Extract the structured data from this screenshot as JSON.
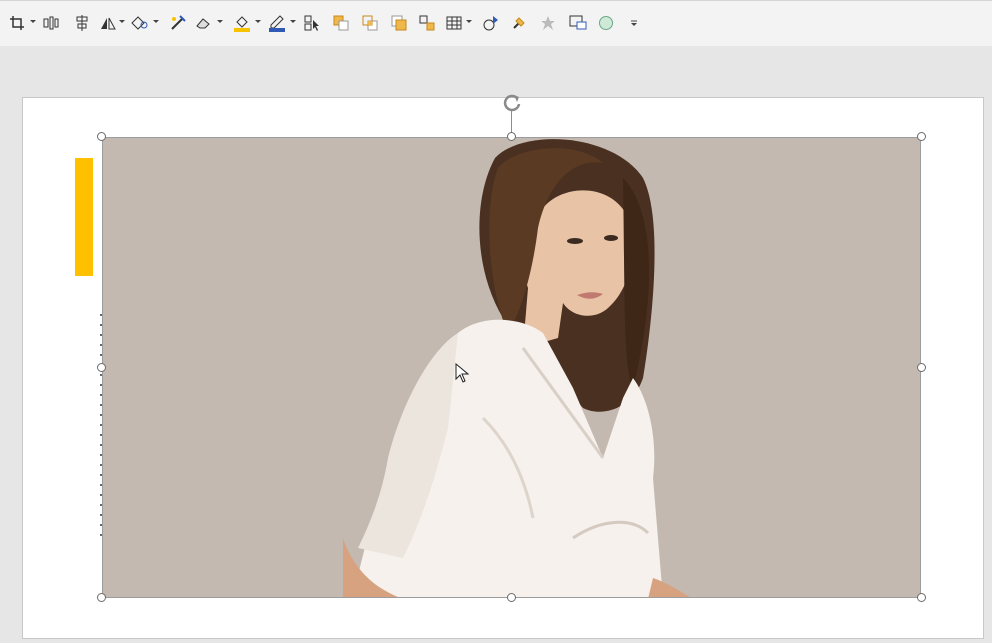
{
  "toolbar": {
    "items": [
      {
        "icon": "crop-icon"
      },
      {
        "icon": "align-objects-icon"
      },
      {
        "icon": "distribute-icon"
      },
      {
        "icon": "rotate-flip-icon"
      },
      {
        "icon": "edit-shape-icon"
      },
      {
        "icon": "artistic-effects-icon"
      },
      {
        "icon": "eraser-icon"
      },
      {
        "icon": "fill-color-icon",
        "accent": "#f7c200"
      },
      {
        "icon": "outline-color-icon",
        "accent": "#2f5bb7"
      },
      {
        "icon": "selection-pane-icon"
      },
      {
        "icon": "bring-forward-icon"
      },
      {
        "icon": "send-backward-icon"
      },
      {
        "icon": "bring-to-front-icon"
      },
      {
        "icon": "group-icon"
      },
      {
        "icon": "table-icon"
      },
      {
        "icon": "animation-pane-icon"
      },
      {
        "icon": "format-painter-icon"
      },
      {
        "icon": "effects-icon"
      },
      {
        "icon": "screen-clipping-icon"
      },
      {
        "icon": "oval-shape-icon"
      },
      {
        "icon": "more-options-icon"
      }
    ]
  },
  "colors": {
    "accent_bar": "#ffc000",
    "picture_background": "#c3b9b0",
    "selection_handle": "#6b6b6b"
  },
  "slide": {
    "picture": {
      "description_icon": "portrait-photo-icon",
      "selected": true
    }
  }
}
